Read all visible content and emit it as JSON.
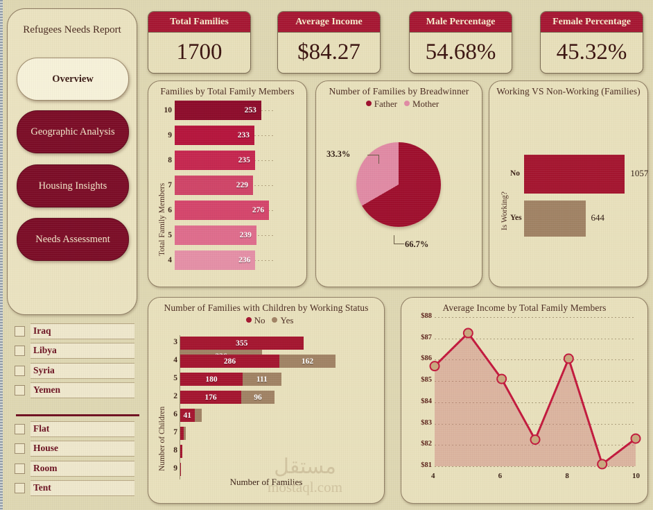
{
  "sidebar": {
    "title": "Refugees Needs Report",
    "nav": [
      {
        "label": "Overview",
        "active": true
      },
      {
        "label": "Geographic Analysis",
        "active": false
      },
      {
        "label": "Housing Insights",
        "active": false
      },
      {
        "label": "Needs Assessment",
        "active": false
      }
    ],
    "country_filters": [
      {
        "label": "Iraq",
        "checked": false
      },
      {
        "label": "Libya",
        "checked": false
      },
      {
        "label": "Syria",
        "checked": false
      },
      {
        "label": "Yemen",
        "checked": false
      }
    ],
    "housing_filters": [
      {
        "label": "Flat",
        "checked": false
      },
      {
        "label": "House",
        "checked": false
      },
      {
        "label": "Room",
        "checked": false
      },
      {
        "label": "Tent",
        "checked": false
      }
    ]
  },
  "kpis": [
    {
      "title": "Total Families",
      "value": "1700"
    },
    {
      "title": "Average Income",
      "value": "$84.27"
    },
    {
      "title": "Male Percentage",
      "value": "54.68%"
    },
    {
      "title": "Female Percentage",
      "value": "45.32%"
    }
  ],
  "watermark": {
    "line1": "مستقل",
    "line2": "mostaql.com"
  },
  "colors": {
    "background": "#ded7b2",
    "card": "#e8e0bc",
    "accent_red": "#a61733",
    "deep_maroon": "#7b0d27",
    "pink": "#e08aa4",
    "tan": "#a08264",
    "border": "#8d7b61"
  },
  "chart_data": [
    {
      "type": "bar",
      "orientation": "horizontal",
      "title": "Families by Total Family Members",
      "ylabel": "Total Family Members",
      "xlabel": "",
      "categories": [
        "10",
        "9",
        "8",
        "7",
        "6",
        "5",
        "4"
      ],
      "values": [
        253,
        233,
        235,
        229,
        276,
        239,
        236
      ],
      "colors": [
        "#8d0c2b",
        "#b5143c",
        "#c5274f",
        "#cf4467",
        "#d4456b",
        "#de6c8c",
        "#e48fa6"
      ],
      "xlim": [
        0,
        300
      ],
      "grid": true
    },
    {
      "type": "pie",
      "title": "Number of Families by Breadwinner",
      "legend_position": "top",
      "labels": [
        "Father",
        "Mother"
      ],
      "values": [
        66.7,
        33.3
      ],
      "value_labels": [
        "66.7%",
        "33.3%"
      ],
      "colors": [
        "#9e0f2d",
        "#e08aa4"
      ]
    },
    {
      "type": "bar",
      "orientation": "horizontal",
      "title": "Working VS Non-Working (Families)",
      "ylabel": "Is Working?",
      "categories": [
        "No",
        "Yes"
      ],
      "values": [
        1057,
        644
      ],
      "value_labels": [
        "1057",
        "644"
      ],
      "colors": [
        "#a4152f",
        "#a08264"
      ],
      "xlim": [
        0,
        1200
      ]
    },
    {
      "type": "bar",
      "orientation": "horizontal",
      "stacked": true,
      "title": "Number of Families with Children by Working Status",
      "ylabel": "Number of Children",
      "xlabel": "Number of Families",
      "legend_position": "top",
      "categories": [
        "3",
        "4",
        "5",
        "2",
        "6",
        "7",
        "8",
        "9"
      ],
      "series": [
        {
          "name": "No",
          "color": "#a4152f",
          "values": [
            355,
            286,
            180,
            176,
            41,
            9,
            5,
            1
          ]
        },
        {
          "name": "Yes",
          "color": "#a08264",
          "values": [
            236,
            162,
            111,
            96,
            20,
            6,
            0,
            0
          ]
        }
      ],
      "value_labels": {
        "No": [
          "355",
          "286",
          "180",
          "176",
          "41",
          "",
          "",
          ""
        ],
        "Yes": [
          "236",
          "162",
          "111",
          "96",
          "",
          "",
          "",
          ""
        ]
      },
      "xlim": [
        0,
        600
      ]
    },
    {
      "type": "line",
      "area": true,
      "title": "Average Income by Total Family Members",
      "xlabel": "",
      "ylabel": "",
      "x": [
        4,
        5,
        6,
        7,
        8,
        9,
        10
      ],
      "values": [
        85.7,
        87.25,
        85.1,
        82.25,
        86.05,
        81.1,
        82.3
      ],
      "xtick_labels": [
        "4",
        "6",
        "8",
        "10"
      ],
      "xticks": [
        4,
        6,
        8,
        10
      ],
      "ytick_labels": [
        "$81",
        "$82",
        "$83",
        "$84",
        "$85",
        "$86",
        "$87",
        "$88"
      ],
      "ylim": [
        81,
        88
      ],
      "xlim": [
        4,
        10
      ],
      "line_color": "#c2183c",
      "marker_color": "#c9a87e",
      "area_color": "rgba(200,120,120,0.42)",
      "grid": true
    }
  ]
}
